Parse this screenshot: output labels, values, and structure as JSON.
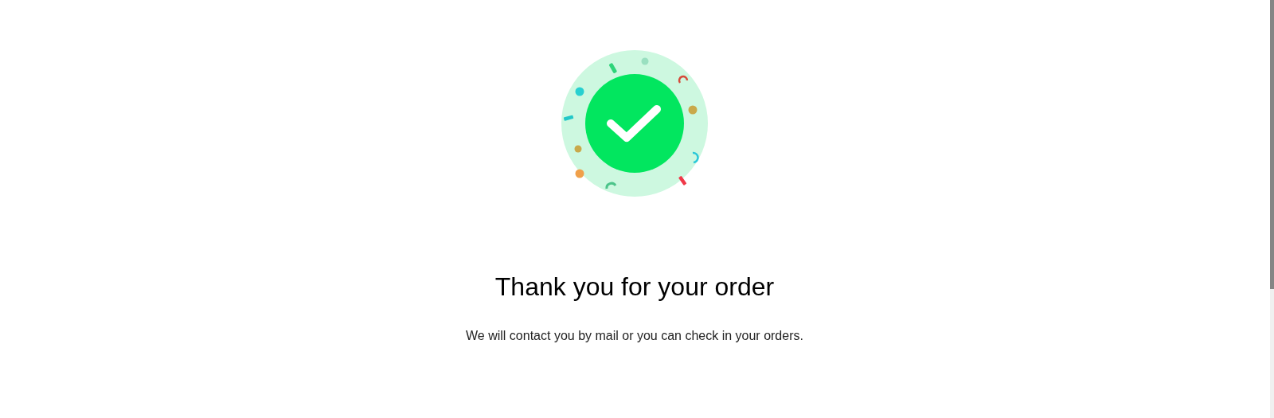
{
  "confirmation": {
    "title": "Thank you for your order",
    "message": "We will contact you by mail or you can check in your orders."
  }
}
